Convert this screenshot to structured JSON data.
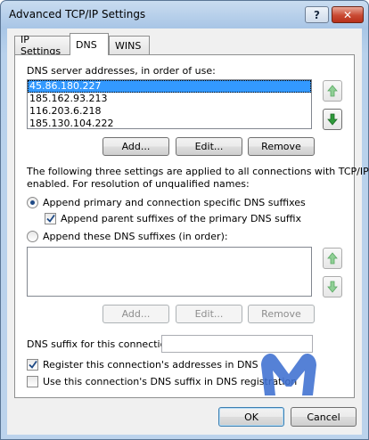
{
  "window": {
    "title": "Advanced TCP/IP Settings",
    "help_label": "?",
    "close_label": "✕"
  },
  "tabs": [
    {
      "label": "IP Settings",
      "selected": false
    },
    {
      "label": "DNS",
      "selected": true
    },
    {
      "label": "WINS",
      "selected": false
    }
  ],
  "dns_servers": {
    "label": "DNS server addresses, in order of use:",
    "items": [
      "45.86.180.227",
      "185.162.93.213",
      "116.203.6.218",
      "185.130.104.222"
    ],
    "selected_index": 0,
    "add_label": "Add...",
    "edit_label": "Edit...",
    "remove_label": "Remove"
  },
  "description": {
    "line1": "The following three settings are applied to all connections with TCP/IP",
    "line2": "enabled. For resolution of unqualified names:"
  },
  "options": {
    "append_primary_label": "Append primary and connection specific DNS suffixes",
    "append_primary_checked": true,
    "append_parent_label": "Append parent suffixes of the primary DNS suffix",
    "append_parent_checked": true,
    "append_these_label": "Append these DNS suffixes (in order):",
    "append_these_checked": false
  },
  "suffixes": {
    "items": [],
    "add_label": "Add...",
    "edit_label": "Edit...",
    "remove_label": "Remove"
  },
  "connection": {
    "suffix_label": "DNS suffix for this connection:",
    "suffix_value": "",
    "register_label": "Register this connection's addresses in DNS",
    "register_checked": true,
    "use_suffix_label": "Use this connection's DNS suffix in DNS registration",
    "use_suffix_checked": false
  },
  "footer": {
    "ok_label": "OK",
    "cancel_label": "Cancel"
  },
  "colors": {
    "selection": "#3399ff",
    "arrow_active": "#2e9a3a",
    "arrow_disabled": "#8fcf95",
    "watermark": "#3d6fd0"
  },
  "icons": {
    "move_up": "up-arrow-icon",
    "move_down": "down-arrow-icon",
    "watermark": "malwarebytes-logo-icon"
  }
}
